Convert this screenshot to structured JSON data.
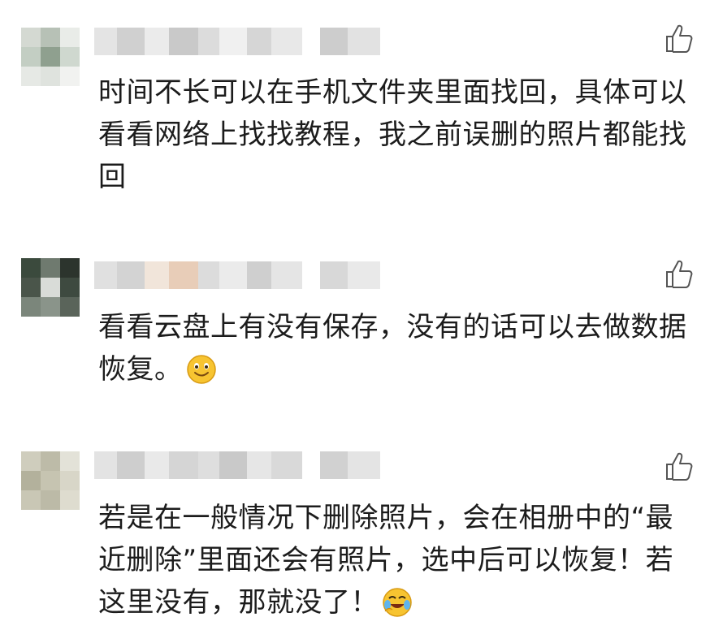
{
  "comments": [
    {
      "text": "时间不长可以在手机文件夹里面找回，具体可以看看网络上找找教程，我之前误删的照片都能找回",
      "emoji": null,
      "avatar_colors": [
        "#d4d9d2",
        "#b7c1b6",
        "#e9ece8",
        "#c3cec3",
        "#8fa08f",
        "#cfd8cf",
        "#e6e9e5",
        "#dfe3de",
        "#f1f2f0"
      ],
      "name_colors": [
        "#e4e4e4",
        "#d0d0d0",
        "#ebebeb",
        "#c9c9c9",
        "#dcdcdc",
        "#f0f0f0",
        "#d6d6d6",
        "#e8e8e8",
        "#ffffff",
        "#cdcdcd",
        "#e2e2e2"
      ]
    },
    {
      "text": "看看云盘上有没有保存，没有的话可以去做数据恢复。",
      "emoji": "smiley",
      "avatar_colors": [
        "#3b4a3d",
        "#6f7a6f",
        "#2c342d",
        "#4a554a",
        "#d9dcd8",
        "#3e4a40",
        "#7b867b",
        "#8a948a",
        "#5a645a"
      ],
      "name_colors": [
        "#e0e0e0",
        "#d3d3d3",
        "#f1e5da",
        "#e8cdb8",
        "#dcdcdc",
        "#ebebeb",
        "#cfcfcf",
        "#e5e5e5",
        "#ffffff",
        "#d8d8d8",
        "#e9e9e9"
      ]
    },
    {
      "text": "若是在一般情况下删除照片，会在相册中的“最近删除”里面还会有照片，选中后可以恢复！若这里没有，那就没了！",
      "emoji": "laugh-cry",
      "avatar_colors": [
        "#cfcdbd",
        "#bdbba8",
        "#e3e2d8",
        "#b3b19c",
        "#c6c4b1",
        "#d8d6c8",
        "#c9c7b5",
        "#bcbaa7",
        "#dedccf"
      ],
      "name_colors": [
        "#e3e3e3",
        "#cecece",
        "#e9e9e9",
        "#d5d5d5",
        "#dedede",
        "#c9c9c9",
        "#e6e6e6",
        "#d9d9d9",
        "#ffffff",
        "#d1d1d1",
        "#e4e4e4"
      ]
    }
  ],
  "colors": {
    "text": "#1c1c1c",
    "icon": "#555555",
    "background": "#ffffff"
  }
}
